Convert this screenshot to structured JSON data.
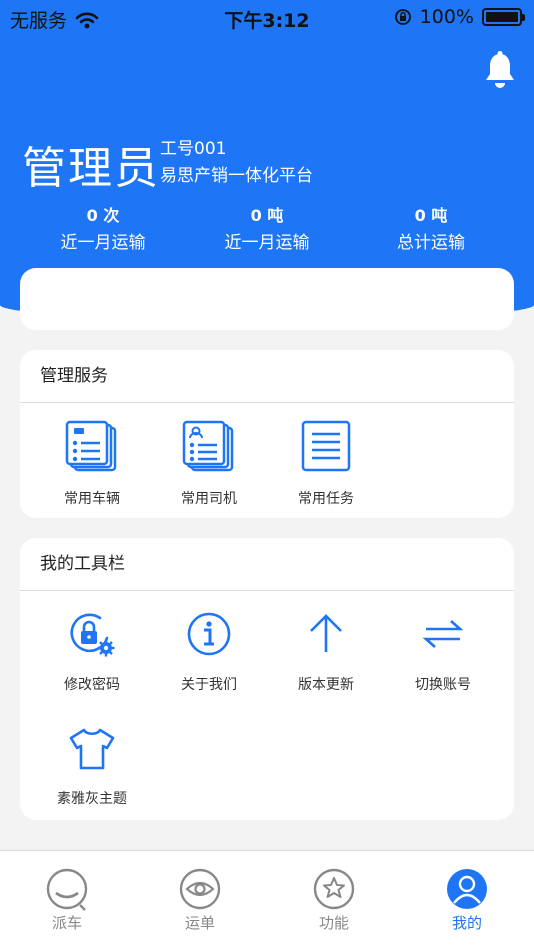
{
  "status_bar": {
    "carrier": "无服务",
    "time": "下午3:12",
    "battery": "100%"
  },
  "header": {
    "role": "管理员",
    "employee_id": "工号001",
    "platform": "易思产销一体化平台",
    "stats": [
      {
        "value": "0 次",
        "label": "近一月运输"
      },
      {
        "value": "0 吨",
        "label": "近一月运输"
      },
      {
        "value": "0 吨",
        "label": "总计运输"
      }
    ]
  },
  "management": {
    "title": "管理服务",
    "items": [
      {
        "label": "常用车辆",
        "icon": "vehicle-list-icon"
      },
      {
        "label": "常用司机",
        "icon": "driver-list-icon"
      },
      {
        "label": "常用任务",
        "icon": "task-list-icon"
      }
    ]
  },
  "toolbar": {
    "title": "我的工具栏",
    "items": [
      {
        "label": "修改密码",
        "icon": "lock-gear-icon"
      },
      {
        "label": "关于我们",
        "icon": "info-icon"
      },
      {
        "label": "版本更新",
        "icon": "arrow-up-icon"
      },
      {
        "label": "切换账号",
        "icon": "swap-icon"
      },
      {
        "label": "素雅灰主题",
        "icon": "tshirt-icon"
      }
    ]
  },
  "tabbar": {
    "tabs": [
      {
        "label": "派车",
        "icon": "dispatch-icon"
      },
      {
        "label": "运单",
        "icon": "eye-icon"
      },
      {
        "label": "功能",
        "icon": "star-icon"
      },
      {
        "label": "我的",
        "icon": "profile-icon",
        "active": true
      }
    ]
  },
  "colors": {
    "primary": "#1e75f5",
    "background": "#f3f3f3",
    "tab_inactive": "#888888"
  }
}
